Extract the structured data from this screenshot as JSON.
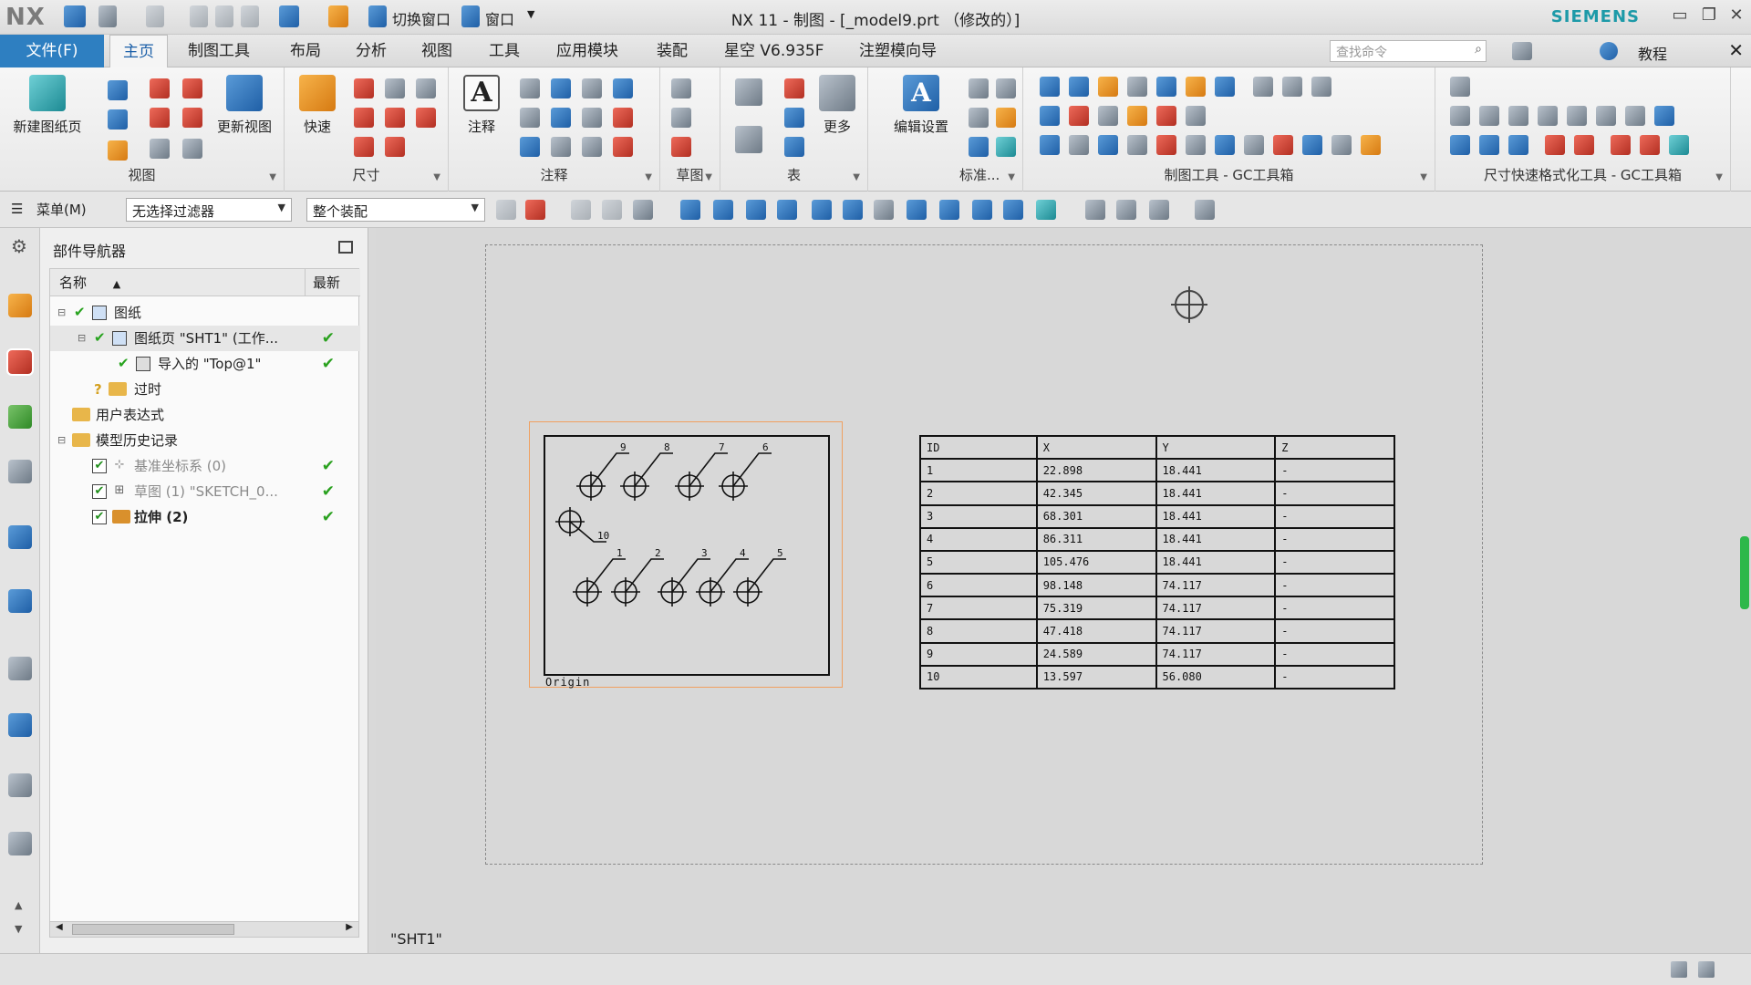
{
  "titlebar": {
    "app_logo": "NX",
    "switch_window_label": "切换窗口",
    "window_label": "窗口",
    "title": "NX 11 - 制图 - [_model9.prt （修改的）]",
    "brand": "SIEMENS"
  },
  "menubar": {
    "file_tab": "文件(F)",
    "tabs": [
      "主页",
      "制图工具",
      "布局",
      "分析",
      "视图",
      "工具",
      "应用模块",
      "装配",
      "星空 V6.935F",
      "注塑模向导"
    ],
    "search_placeholder": "查找命令",
    "tutorial_label": "教程"
  },
  "ribbon": {
    "groups": [
      {
        "label": "视图",
        "big_buttons": [
          "新建图纸页",
          "更新视图"
        ]
      },
      {
        "label": "尺寸",
        "big_buttons": [
          "快速"
        ]
      },
      {
        "label": "注释",
        "big_buttons": [
          "注释"
        ]
      },
      {
        "label": "草图"
      },
      {
        "label": "表",
        "big_buttons": [
          "更多"
        ]
      },
      {
        "label": "标准...",
        "big_buttons": [
          "编辑设置"
        ]
      },
      {
        "label": "制图工具 - GC工具箱"
      },
      {
        "label": "尺寸快速格式化工具 - GC工具箱"
      }
    ]
  },
  "selbar": {
    "menu_label": "菜单(M)",
    "filter_value": "无选择过滤器",
    "scope_value": "整个装配"
  },
  "navigator": {
    "title": "部件导航器",
    "col_name": "名称",
    "col_latest": "最新",
    "rows": [
      {
        "text": "图纸"
      },
      {
        "text": "图纸页 \"SHT1\" (工作..."
      },
      {
        "text": "导入的 \"Top@1\""
      },
      {
        "text": "过时"
      },
      {
        "text": "用户表达式"
      },
      {
        "text": "模型历史记录"
      },
      {
        "text": "基准坐标系 (0)"
      },
      {
        "text": "草图 (1) \"SKETCH_0..."
      },
      {
        "text": "拉伸 (2)"
      }
    ]
  },
  "drawing": {
    "sheet_label": "\"SHT1\"",
    "origin_label": "Origin",
    "hole_labels_top": [
      "9",
      "8",
      "7",
      "6"
    ],
    "hole_labels_bottom": [
      "1",
      "2",
      "3",
      "4",
      "5"
    ],
    "hole_label_mid": "10",
    "table_headers": [
      "ID",
      "X",
      "Y",
      "Z"
    ],
    "table_rows": [
      [
        "1",
        "22.898",
        "18.441",
        "-"
      ],
      [
        "2",
        "42.345",
        "18.441",
        "-"
      ],
      [
        "3",
        "68.301",
        "18.441",
        "-"
      ],
      [
        "4",
        "86.311",
        "18.441",
        "-"
      ],
      [
        "5",
        "105.476",
        "18.441",
        "-"
      ],
      [
        "6",
        "98.148",
        "74.117",
        "-"
      ],
      [
        "7",
        "75.319",
        "74.117",
        "-"
      ],
      [
        "8",
        "47.418",
        "74.117",
        "-"
      ],
      [
        "9",
        "24.589",
        "74.117",
        "-"
      ],
      [
        "10",
        "13.597",
        "56.080",
        "-"
      ]
    ]
  },
  "colors": {
    "accent": "#2e7fc1",
    "ok_green": "#2aa11f",
    "view_highlight": "#f0a060"
  }
}
